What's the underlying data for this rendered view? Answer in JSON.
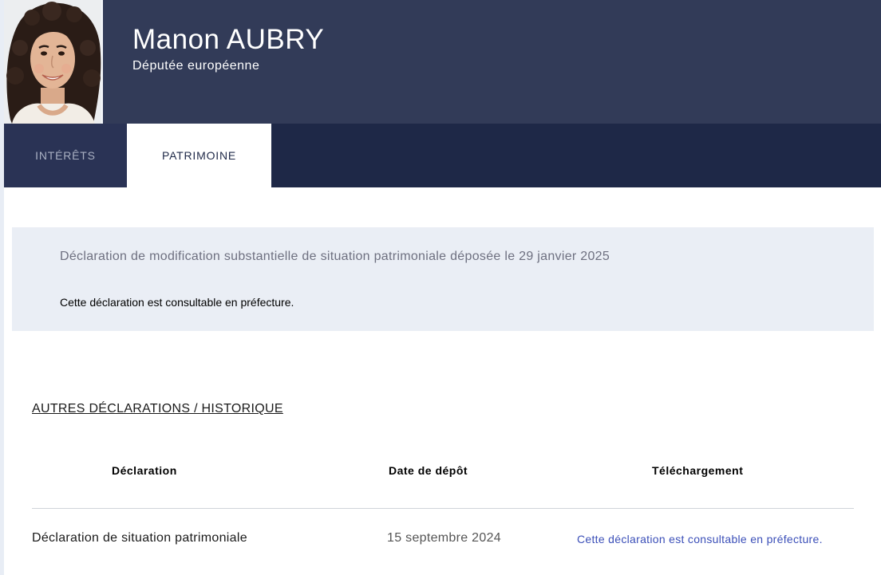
{
  "profile": {
    "name": "Manon AUBRY",
    "role": "Députée européenne"
  },
  "tabs": [
    {
      "label": "INTÉRÊTS",
      "active": false
    },
    {
      "label": "PATRIMOINE",
      "active": true
    }
  ],
  "current_declaration": {
    "title": "Déclaration de modification substantielle de situation patrimoniale déposée le 29 janvier 2025",
    "note": "Cette déclaration est consultable en préfecture."
  },
  "history": {
    "title": "AUTRES DÉCLARATIONS / HISTORIQUE",
    "columns": [
      "Déclaration",
      "Date de dépôt",
      "Téléchargement"
    ],
    "rows": [
      {
        "declaration": "Déclaration de situation patrimoniale",
        "date": "15 septembre 2024",
        "download": "Cette déclaration est consultable en préfecture."
      }
    ]
  },
  "colors": {
    "header": "#323b58",
    "tabs_bar": "#1e2847",
    "info_box": "#eaeef5",
    "link": "#3b4fb8"
  }
}
